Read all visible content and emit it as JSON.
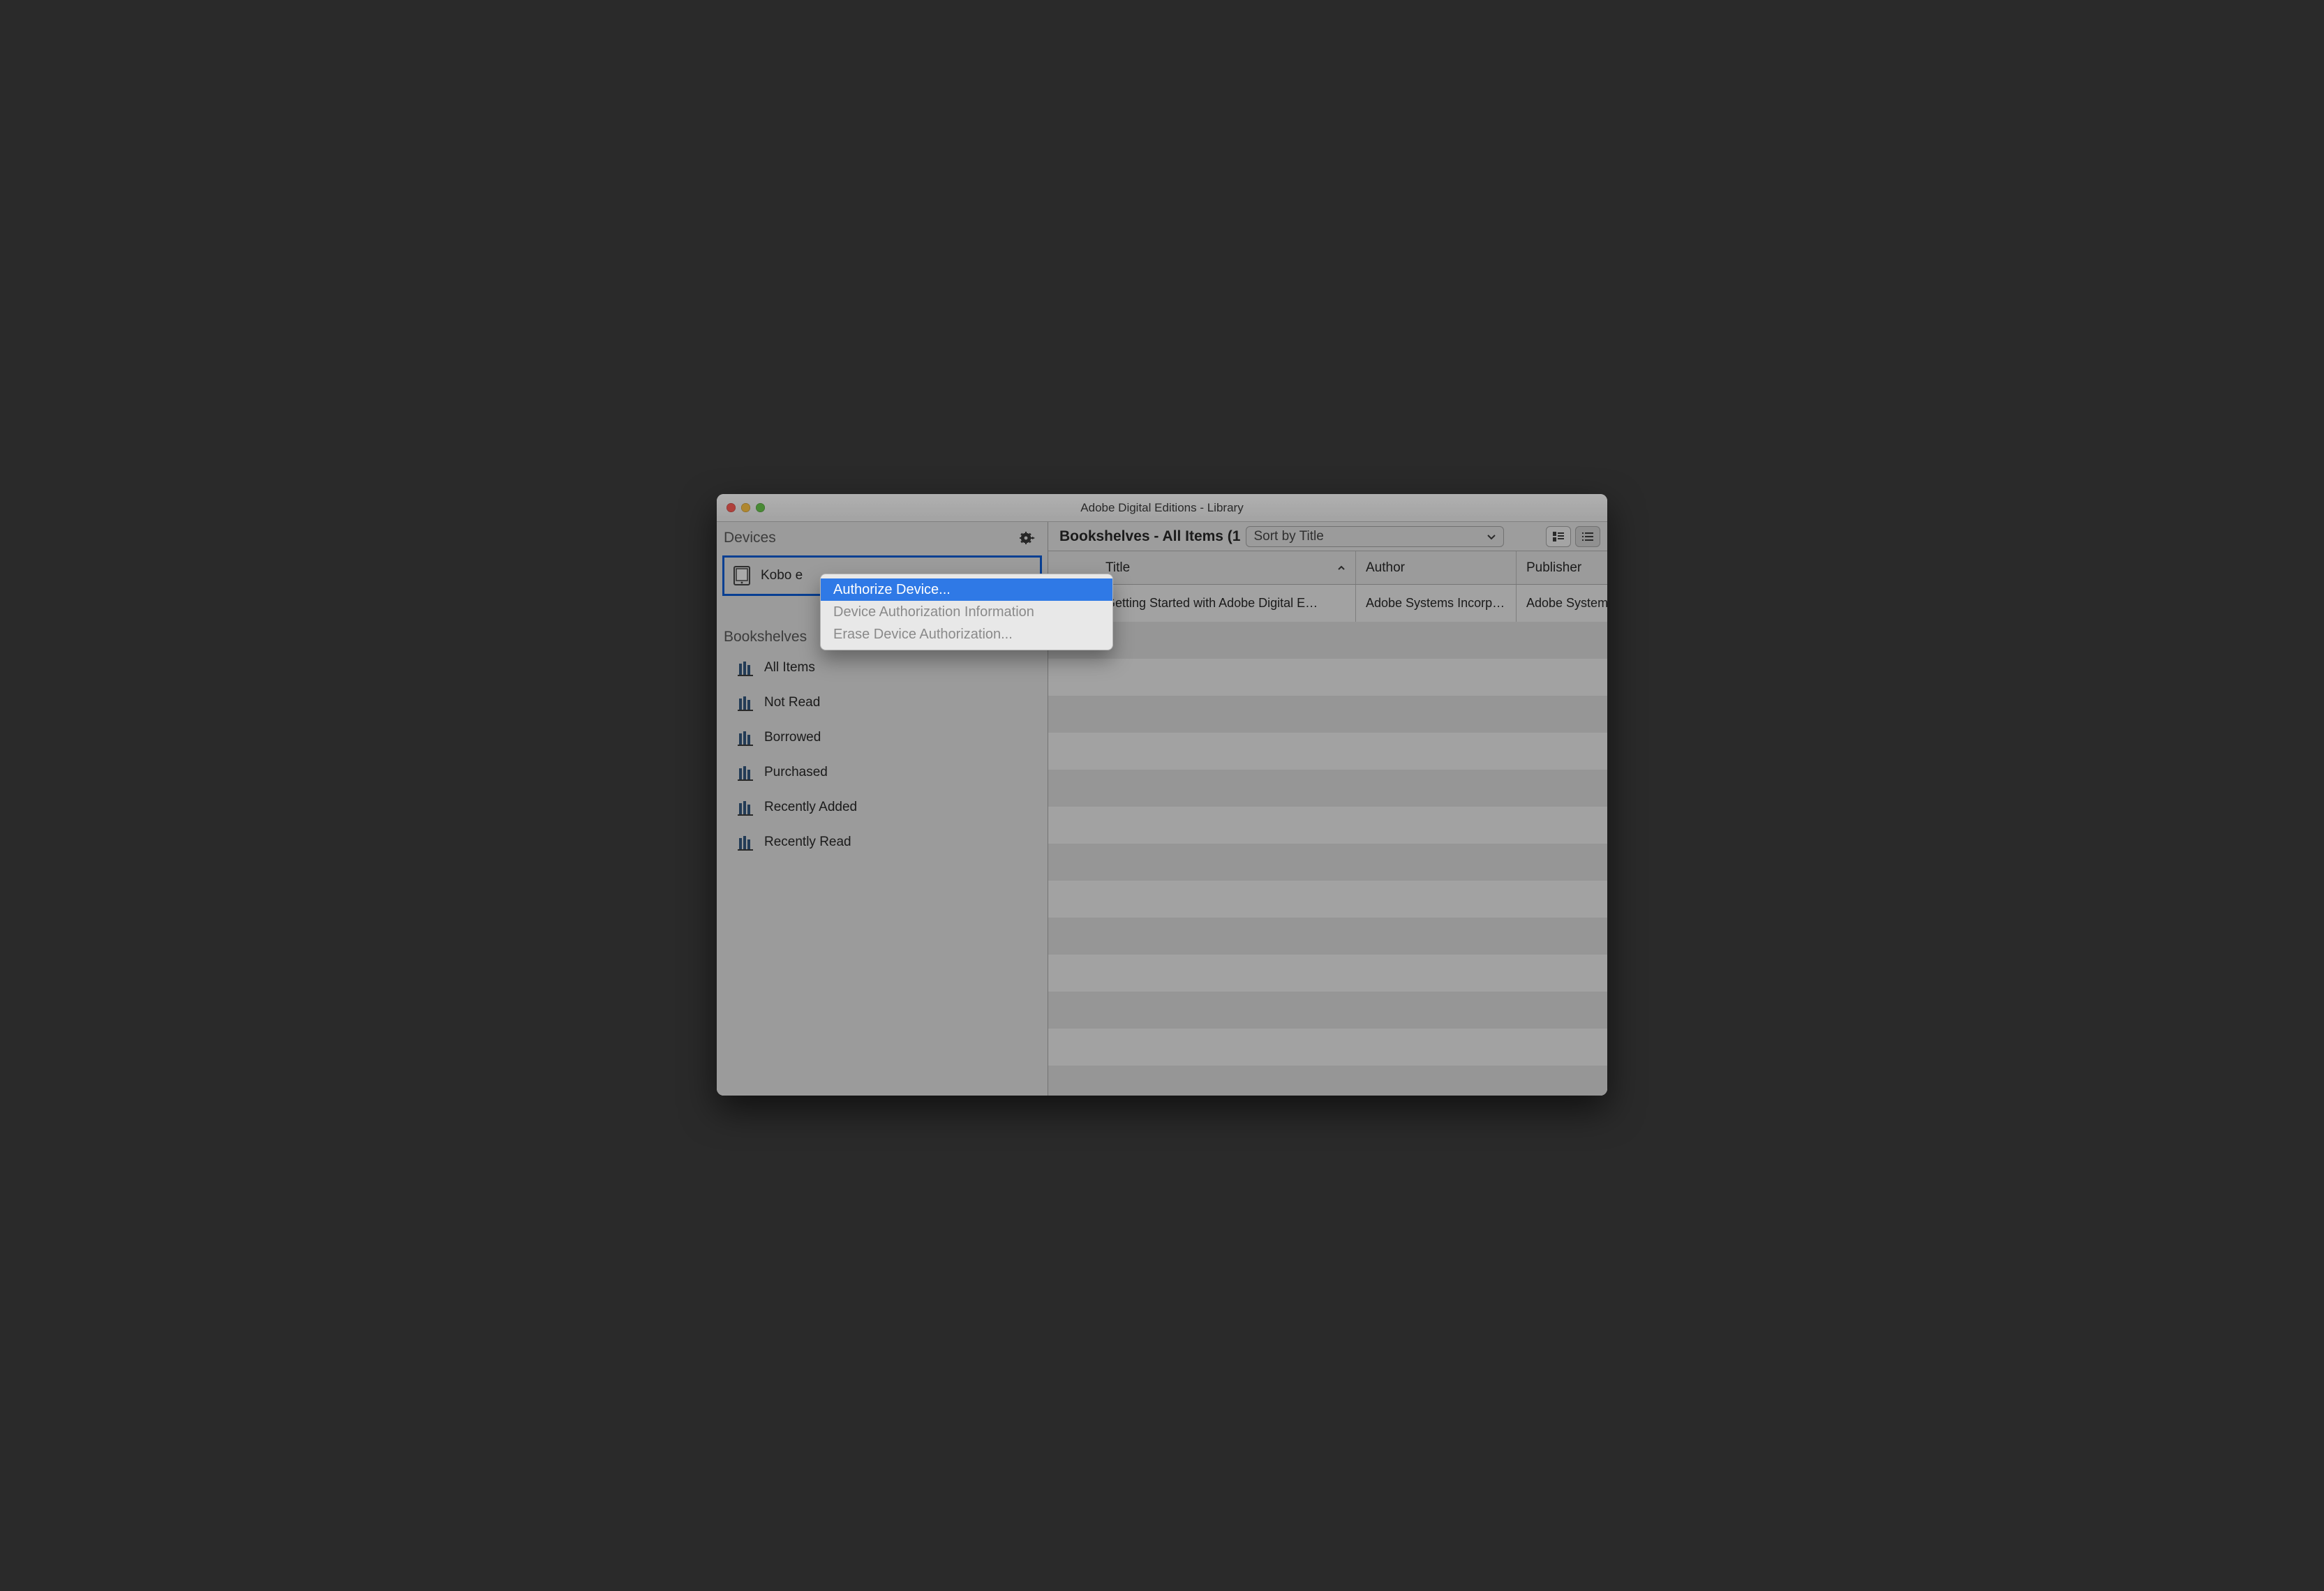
{
  "window": {
    "title": "Adobe Digital Editions - Library"
  },
  "sidebar": {
    "devices_label": "Devices",
    "device_name": "Kobo e",
    "bookshelves_label": "Bookshelves",
    "shelves": [
      {
        "label": "All Items"
      },
      {
        "label": "Not Read"
      },
      {
        "label": "Borrowed"
      },
      {
        "label": "Purchased"
      },
      {
        "label": "Recently Added"
      },
      {
        "label": "Recently Read"
      }
    ]
  },
  "main": {
    "shelf_title": "Bookshelves - All Items (1",
    "sort_label": "Sort by Title",
    "columns": {
      "title": "Title",
      "author": "Author",
      "publisher": "Publisher"
    },
    "rows": [
      {
        "title": "Getting Started with Adobe Digital E…",
        "author": "Adobe Systems Incorp…",
        "publisher": "Adobe System"
      }
    ]
  },
  "menu": {
    "items": [
      {
        "label": "Authorize Device...",
        "enabled": true
      },
      {
        "label": "Device Authorization Information",
        "enabled": false
      },
      {
        "label": "Erase Device Authorization...",
        "enabled": false
      }
    ]
  }
}
